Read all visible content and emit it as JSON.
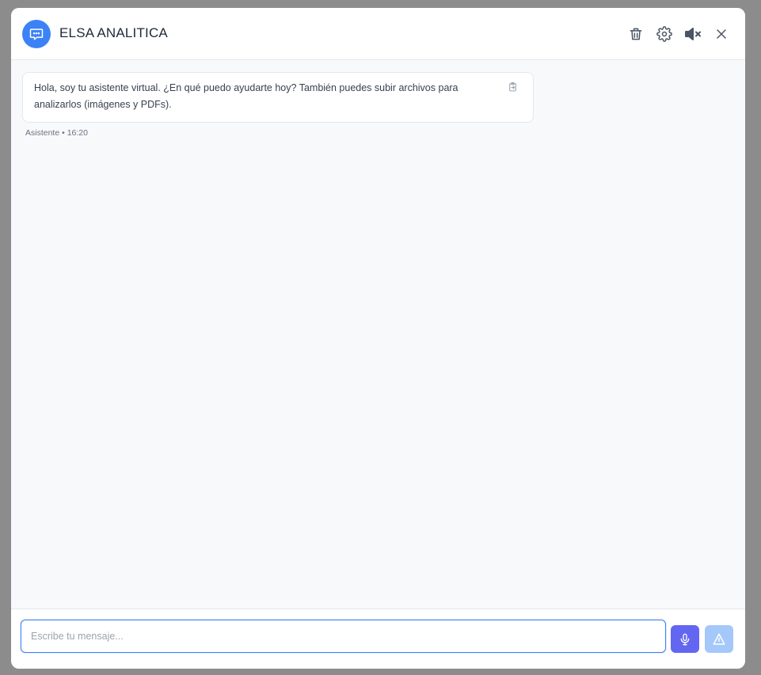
{
  "header": {
    "title": "ELSA ANALITICA",
    "icons": [
      "chat-bubble-icon",
      "trash-icon",
      "gear-icon",
      "volume-mute-icon",
      "close-icon"
    ]
  },
  "messages": [
    {
      "role": "assistant",
      "text": "Hola, soy tu asistente virtual. ¿En qué puedo ayudarte hoy? También puedes subir archivos para analizarlos (imágenes y PDFs).",
      "meta": "Asistente • 16:20",
      "action_icon": "copy-icon"
    }
  ],
  "composer": {
    "placeholder": "Escribe tu mensaje...",
    "value": ""
  },
  "colors": {
    "accent": "#3b82f6",
    "mic_button": "#6366f1",
    "send_button_disabled": "#a5c8fb",
    "backdrop": "#8c8c8c"
  }
}
